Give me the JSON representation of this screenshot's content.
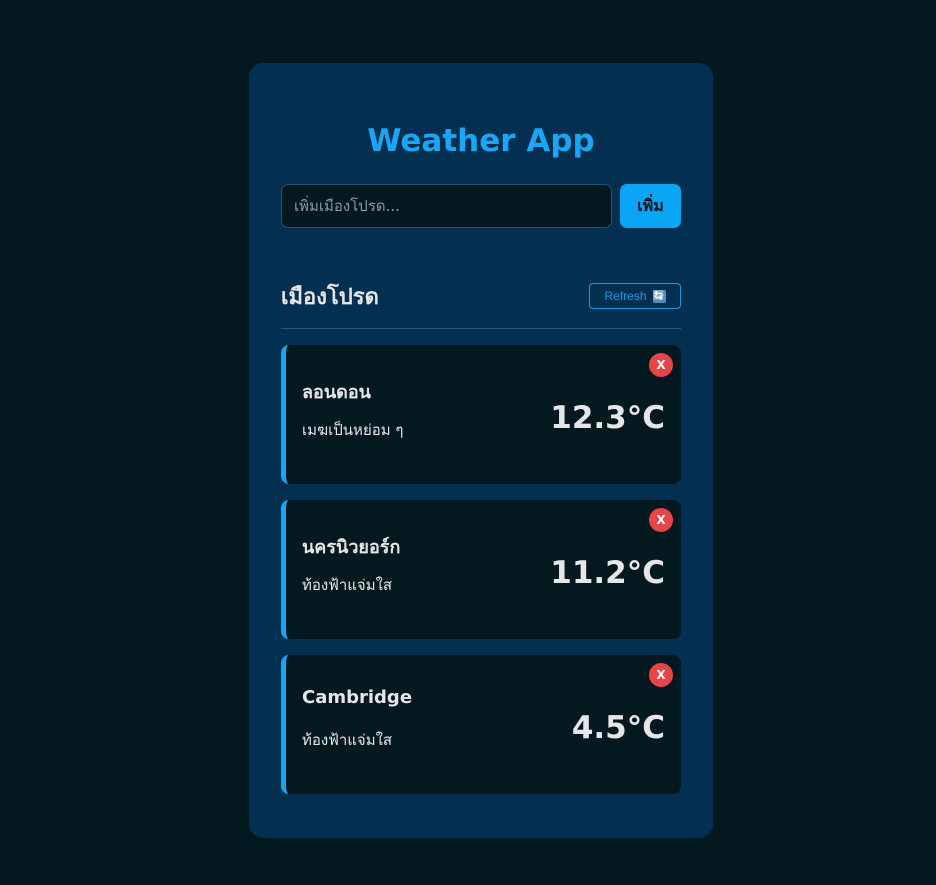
{
  "app": {
    "title": "Weather App"
  },
  "search": {
    "placeholder": "เพิ่มเมืองโปรด...",
    "value": "",
    "add_label": "เพิ่ม"
  },
  "favorites": {
    "title": "เมืองโปรด",
    "refresh_label": "Refresh",
    "refresh_icon": "🔄",
    "remove_label": "X",
    "cities": [
      {
        "name": "ลอนดอน",
        "description": "เมฆเป็นหย่อม ๆ",
        "temperature": "12.3°C"
      },
      {
        "name": "นครนิวยอร์ก",
        "description": "ท้องฟ้าแจ่มใส",
        "temperature": "11.2°C"
      },
      {
        "name": "Cambridge",
        "description": "ท้องฟ้าแจ่มใส",
        "temperature": "4.5°C"
      }
    ]
  },
  "colors": {
    "page_background": "#041820",
    "panel_background": "#033050",
    "accent": "#1aa6f5",
    "danger": "#e8454a",
    "text": "#e6e6e6"
  }
}
